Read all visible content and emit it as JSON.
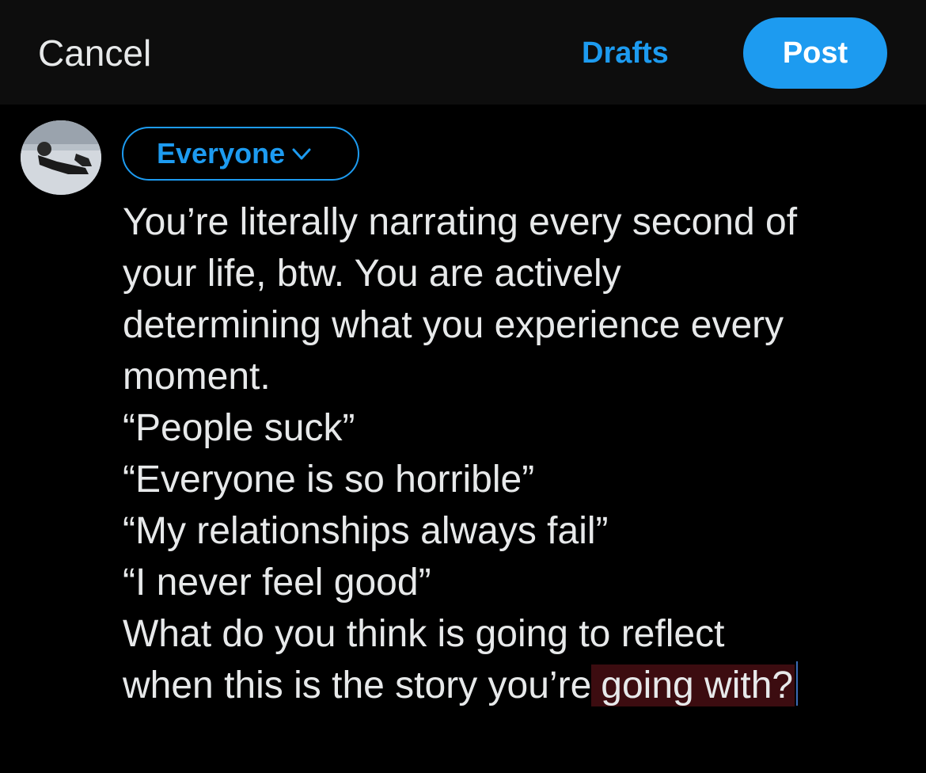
{
  "header": {
    "cancel_label": "Cancel",
    "drafts_label": "Drafts",
    "post_label": "Post"
  },
  "audience": {
    "label": "Everyone",
    "icon": "chevron-down-icon"
  },
  "composer": {
    "lines": [
      "You’re literally narrating every second of",
      "your life, btw. You are actively",
      "determining what you experience every",
      "moment.",
      "“People suck”",
      "“Everyone is so horrible”",
      "“My relationships always fail”",
      "“I never feel good”",
      "What do you think is going to reflect"
    ],
    "last_line_prefix": "when this is the story you’re",
    "selected_text": "going with?"
  },
  "colors": {
    "accent": "#1d9bf0",
    "background": "#000000",
    "top_bar": "#0d0d0d",
    "text": "#e7e9ea",
    "selection": "#3c0c10"
  }
}
